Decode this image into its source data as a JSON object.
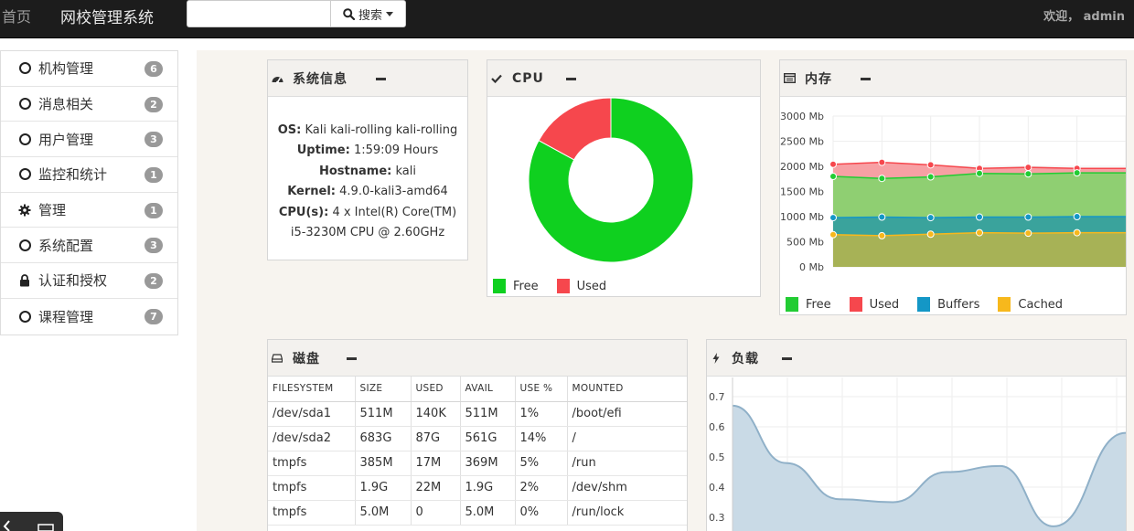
{
  "nav": {
    "home": "首页",
    "brand": "网校管理系统",
    "search_label": "搜索",
    "search_placeholder": "",
    "welcome": "欢迎， admin"
  },
  "sidebar": {
    "items": [
      {
        "label": "机构管理",
        "badge": "6",
        "icon": "circle-icon"
      },
      {
        "label": "消息相关",
        "badge": "2",
        "icon": "circle-icon"
      },
      {
        "label": "用户管理",
        "badge": "3",
        "icon": "circle-icon"
      },
      {
        "label": "监控和统计",
        "badge": "1",
        "icon": "circle-icon"
      },
      {
        "label": "管理",
        "badge": "1",
        "icon": "gear-icon"
      },
      {
        "label": "系统配置",
        "badge": "3",
        "icon": "circle-icon"
      },
      {
        "label": "认证和授权",
        "badge": "2",
        "icon": "lock-icon"
      },
      {
        "label": "课程管理",
        "badge": "7",
        "icon": "circle-icon"
      }
    ]
  },
  "sysinfo": {
    "title": "系统信息",
    "os_label": "OS:",
    "os": "Kali kali-rolling kali-rolling",
    "uptime_label": "Uptime:",
    "uptime": "1:59:09 Hours",
    "hostname_label": "Hostname:",
    "hostname": "kali",
    "kernel_label": "Kernel:",
    "kernel": "4.9.0-kali3-amd64",
    "cpu_label": "CPU(s):",
    "cpu_line1": "4 x Intel(R) Core(TM)",
    "cpu_line2": "i5-3230M CPU @ 2.60GHz"
  },
  "cpu": {
    "title": "CPU",
    "legend": [
      {
        "label": "Free",
        "color": "#0fd01f"
      },
      {
        "label": "Used",
        "color": "#f6474d"
      }
    ]
  },
  "memory": {
    "title": "内存",
    "legend": [
      {
        "label": "Free",
        "color": "#22cc33"
      },
      {
        "label": "Used",
        "color": "#f6474d"
      },
      {
        "label": "Buffers",
        "color": "#1497c6"
      },
      {
        "label": "Cached",
        "color": "#f7b81c"
      }
    ]
  },
  "disk": {
    "title": "磁盘",
    "columns": [
      "FILESYSTEM",
      "SIZE",
      "USED",
      "AVAIL",
      "USE %",
      "MOUNTED"
    ],
    "rows": [
      [
        "/dev/sda1",
        "511M",
        "140K",
        "511M",
        "1%",
        "/boot/efi"
      ],
      [
        "/dev/sda2",
        "683G",
        "87G",
        "561G",
        "14%",
        "/"
      ],
      [
        "tmpfs",
        "385M",
        "17M",
        "369M",
        "5%",
        "/run"
      ],
      [
        "tmpfs",
        "1.9G",
        "22M",
        "1.9G",
        "2%",
        "/dev/shm"
      ],
      [
        "tmpfs",
        "5.0M",
        "0",
        "5.0M",
        "0%",
        "/run/lock"
      ]
    ]
  },
  "load": {
    "title": "负载"
  },
  "chart_data": [
    {
      "type": "pie",
      "categories": [
        "Free",
        "Used"
      ],
      "values": [
        83,
        17
      ],
      "colors": [
        "#0fd01f",
        "#f6474d"
      ],
      "title": ""
    },
    {
      "type": "area",
      "x": [
        1,
        2,
        3,
        4,
        5,
        6,
        7
      ],
      "ylim": [
        0,
        3000
      ],
      "yticks": [
        "0 Mb",
        "500 Mb",
        "1000 Mb",
        "1500 Mb",
        "2000 Mb",
        "2500 Mb",
        "3000 Mb"
      ],
      "series": [
        {
          "name": "Free",
          "values": [
            1800,
            1760,
            1790,
            1860,
            1850,
            1870,
            1870
          ],
          "color": "#22cc33"
        },
        {
          "name": "Used",
          "values": [
            2040,
            2080,
            2030,
            1960,
            1980,
            1960,
            1960
          ],
          "color": "#f6474d"
        },
        {
          "name": "Buffers",
          "values": [
            980,
            990,
            980,
            990,
            990,
            1000,
            1000
          ],
          "color": "#1497c6"
        },
        {
          "name": "Cached",
          "values": [
            640,
            620,
            650,
            680,
            670,
            680,
            680
          ],
          "color": "#f7b81c"
        }
      ],
      "grid": true
    },
    {
      "type": "area",
      "x": [
        0,
        1,
        2,
        3,
        4,
        5,
        6,
        7,
        8
      ],
      "yticks": [
        "0.3",
        "0.4",
        "0.5",
        "0.6",
        "0.7"
      ],
      "series": [
        {
          "values": [
            0.67,
            0.48,
            0.36,
            0.35,
            0.45,
            0.47,
            0.27,
            0.58
          ],
          "color": "#8fb0c8"
        }
      ],
      "grid": true
    }
  ]
}
